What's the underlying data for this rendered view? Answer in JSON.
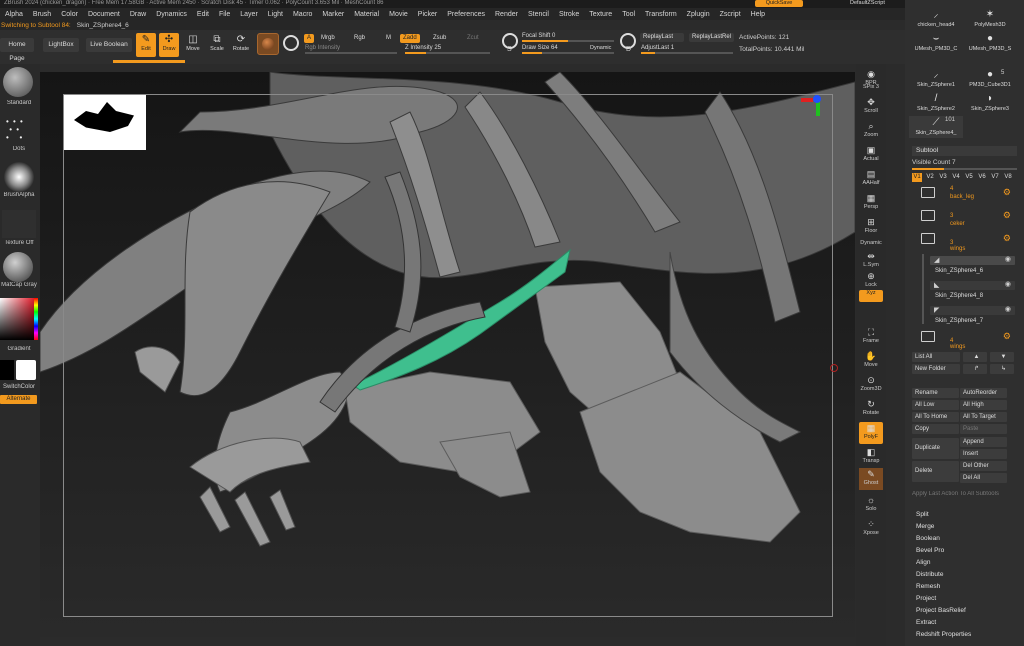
{
  "title_bar": "ZBrush 2024 (chicken_dragon) · Free Mem 17.58GB · Active Mem 2450 · Scratch Disk 45 · Timer 0.062 · PolyCount 3.653 Mil · MeshCount 86",
  "title_right": {
    "quicksave": "QuickSave",
    "script": "DefaultZScript"
  },
  "menu": [
    "Alpha",
    "Brush",
    "Color",
    "Document",
    "Draw",
    "Dynamics",
    "Edit",
    "File",
    "Layer",
    "Light",
    "Macro",
    "Marker",
    "Material",
    "Movie",
    "Picker",
    "Preferences",
    "Render",
    "Stencil",
    "Stroke",
    "Texture",
    "Tool",
    "Transform",
    "Zplugin",
    "Zscript",
    "Help"
  ],
  "status": {
    "message": "Switching to Subtool 84:",
    "subtool": "Skin_ZSphere4_6"
  },
  "toolbar": {
    "home_page": "Home Page",
    "lightbox": "LightBox",
    "live_boolean": "Live Boolean",
    "edit": "Edit",
    "draw": "Draw",
    "move": "Move",
    "scale": "Scale",
    "rotate": "Rotate",
    "a": "A",
    "mrgb": "Mrgb",
    "rgb": "Rgb",
    "m": "M",
    "zadd": "Zadd",
    "zsub": "Zsub",
    "zcut": "Zcut",
    "rgb_intensity": "Rgb Intensity",
    "z_intensity_label": "Z Intensity",
    "z_intensity": "25",
    "focal_shift_label": "Focal Shift",
    "focal_shift": "0",
    "draw_size_label": "Draw Size",
    "draw_size": "64",
    "dynamic": "Dynamic",
    "replay_last": "ReplayLast",
    "replay_last_rel": "ReplayLastRel",
    "adjust_last_label": "AdjustLast",
    "adjust_last": "1",
    "active_points_label": "ActivePoints:",
    "active_points": "121",
    "total_points_label": "TotalPoints:",
    "total_points": "10.441 Mil",
    "s_mark": "S",
    "d_mark": "D"
  },
  "left_panel": {
    "standard": "Standard",
    "dots": "Dots",
    "brush_alpha": "BrushAlpha",
    "texture_off": "Texture Off",
    "material": "MatCap Gray",
    "gradient": "Gradient",
    "switch_color": "SwitchColor",
    "alternate": "Alternate"
  },
  "shelf": [
    "BPR",
    "SPix 3",
    "Scroll",
    "Zoom",
    "Actual",
    "AAHalf",
    "Persp",
    "Floor",
    "Dynamic",
    "L.Sym",
    "Lock",
    "Xyz",
    "Frame",
    "Move",
    "Zoom3D",
    "Rotate",
    "PolyF",
    "Transp",
    "Ghost",
    "Solo",
    "Xpose"
  ],
  "tool_palette": {
    "tools": [
      "chicken_head4",
      "PolyMesh3D",
      "UMesh_PM3D_C",
      "UMesh_PM3D_S",
      "Skin_ZSphere1",
      "PM3D_Cube3D1",
      "Skin_ZSphere2",
      "Skin_ZSphere3",
      "Skin_ZSphere4_"
    ],
    "count_5": "5",
    "count_101": "101"
  },
  "subtool": {
    "header": "Subtool",
    "visible_count_label": "Visible Count",
    "visible_count": "7",
    "tabs": [
      "V1",
      "V2",
      "V3",
      "V4",
      "V5",
      "V6",
      "V7",
      "V8"
    ],
    "folders": [
      {
        "count": "4",
        "name": "back_leg"
      },
      {
        "count": "3",
        "name": "ceker"
      },
      {
        "count": "3",
        "name": "wings"
      }
    ],
    "meshes": [
      "Skin_ZSphere4_6",
      "Skin_ZSphere4_8",
      "Skin_ZSphere4_7"
    ],
    "folder_last": {
      "count": "4",
      "name": "wings"
    },
    "buttons": {
      "list_all": "List All",
      "new_folder": "New Folder",
      "rename": "Rename",
      "auto_reorder": "AutoReorder",
      "all_low": "All Low",
      "all_high": "All High",
      "all_to_home": "All To Home",
      "all_to_target": "All To Target",
      "copy": "Copy",
      "paste": "Paste",
      "duplicate": "Duplicate",
      "append": "Append",
      "insert": "Insert",
      "delete": "Delete",
      "del_other": "Del Other",
      "del_all": "Del All",
      "apply_last": "Apply Last Action To All Subtools"
    },
    "menus": [
      "Split",
      "Merge",
      "Boolean",
      "Bevel Pro",
      "Align",
      "Distribute",
      "Remesh",
      "Project",
      "Project BasRelief",
      "Extract",
      "Redshift Properties"
    ]
  },
  "colors": {
    "accent": "#f39a1e",
    "highlight_polys": "#3fbf8e"
  }
}
